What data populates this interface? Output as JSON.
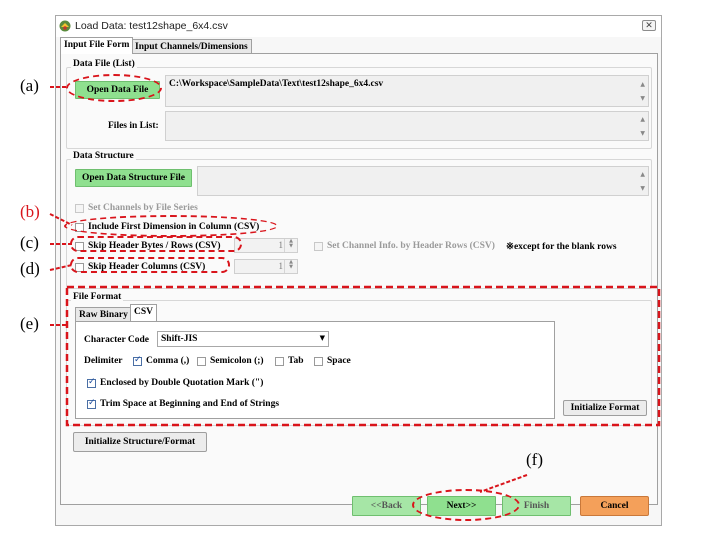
{
  "window": {
    "title": "Load Data: test12shape_6x4.csv",
    "close_glyph": "✕"
  },
  "tabs": [
    {
      "label": "Input File Form",
      "active": true
    },
    {
      "label": "Input Channels/Dimensions",
      "active": false
    }
  ],
  "data_file": {
    "group_title": "Data File (List)",
    "open_button": "Open Data File",
    "path": "C:\\Workspace\\SampleData\\Text\\test12shape_6x4.csv",
    "files_in_list_label": "Files in List:"
  },
  "data_structure": {
    "group_title": "Data Structure",
    "open_button": "Open Data Structure File",
    "set_channels_label": "Set Channels by File Series",
    "include_first_dim_label": "Include First Dimension in Column (CSV)",
    "skip_header_rows_label": "Skip Header Bytes / Rows (CSV)",
    "skip_header_rows_value": "1",
    "set_channel_info_label": "Set Channel Info. by Header Rows (CSV)",
    "note": "※except for the blank rows",
    "skip_header_cols_label": "Skip Header Columns (CSV)",
    "skip_header_cols_value": "1"
  },
  "file_format": {
    "group_title": "File Format",
    "tabs": [
      {
        "label": "Raw Binary",
        "active": false
      },
      {
        "label": "CSV",
        "active": true
      }
    ],
    "character_code_label": "Character Code",
    "character_code_value": "Shift-JIS",
    "delimiter_label": "Delimiter",
    "delimiters": [
      {
        "label": "Comma (,)",
        "checked": true
      },
      {
        "label": "Semicolon (;)",
        "checked": false
      },
      {
        "label": "Tab",
        "checked": false
      },
      {
        "label": "Space",
        "checked": false
      }
    ],
    "enclosed_label": "Enclosed by Double Quotation Mark (\")",
    "enclosed_checked": true,
    "trim_label": "Trim Space at Beginning and End of Strings",
    "trim_checked": true,
    "initialize_format_button": "Initialize Format"
  },
  "initialize_structure_button": "Initialize Structure/Format",
  "footer": {
    "back": "<<Back",
    "next": "Next>>",
    "finish": "Finish",
    "cancel": "Cancel"
  },
  "annotations": {
    "a": "(a)",
    "b": "(b)",
    "c": "(c)",
    "d": "(d)",
    "e": "(e)",
    "f": "(f)"
  },
  "colors": {
    "annotation_red": "#d9141b",
    "green_button": "#8fe08f",
    "cancel_button": "#f4a05a"
  }
}
